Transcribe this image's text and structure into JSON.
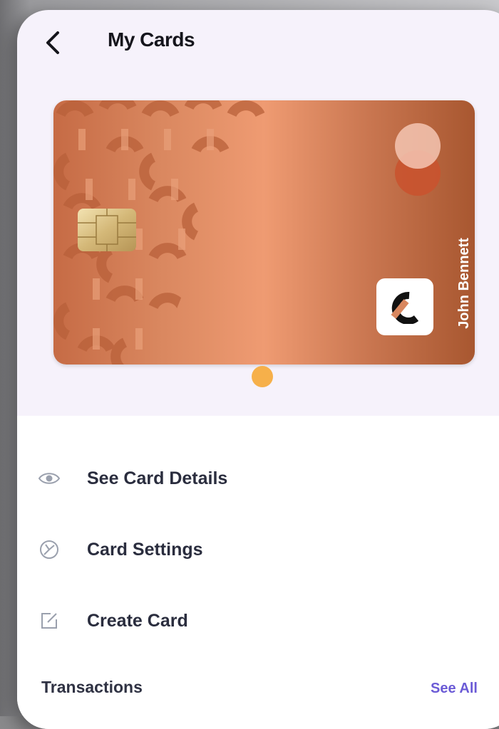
{
  "header": {
    "title": "My Cards"
  },
  "card": {
    "holder_name": "John Bennett",
    "network": "mastercard"
  },
  "menu": {
    "items": [
      {
        "label": "See Card Details",
        "icon": "eye-icon"
      },
      {
        "label": "Card Settings",
        "icon": "settings-icon"
      },
      {
        "label": "Create Card",
        "icon": "edit-square-icon"
      }
    ]
  },
  "transactions": {
    "title": "Transactions",
    "see_all": "See All"
  },
  "colors": {
    "accent": "#6b5bd6",
    "page_dot": "#f6b04a",
    "card_copper": "#d9875f"
  }
}
